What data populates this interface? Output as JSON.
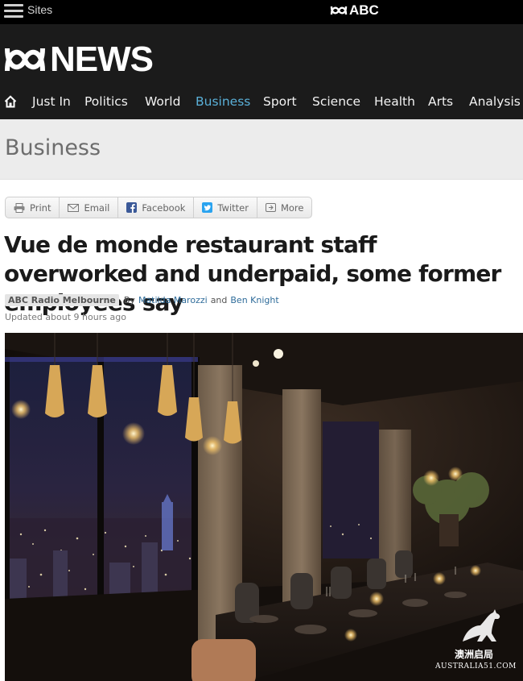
{
  "topbar": {
    "sites_label": "Sites",
    "abc_label": "ABC"
  },
  "brand": {
    "news_label": "NEWS"
  },
  "nav": {
    "items": [
      {
        "label": "Just In"
      },
      {
        "label": "Politics"
      },
      {
        "label": "World"
      },
      {
        "label": "Business"
      },
      {
        "label": "Sport"
      },
      {
        "label": "Science"
      },
      {
        "label": "Health"
      },
      {
        "label": "Arts"
      },
      {
        "label": "Analysis"
      }
    ],
    "active": "Business",
    "active_color": "#5ab0d8"
  },
  "section": {
    "title": "Business"
  },
  "share": {
    "buttons": [
      {
        "label": "Print",
        "icon": "printer-icon"
      },
      {
        "label": "Email",
        "icon": "envelope-icon"
      },
      {
        "label": "Facebook",
        "icon": "facebook-icon"
      },
      {
        "label": "Twitter",
        "icon": "twitter-icon"
      },
      {
        "label": "More",
        "icon": "more-icon"
      }
    ]
  },
  "article": {
    "headline": "Vue de monde restaurant staff overworked and underpaid, some former employees say",
    "program": "ABC Radio Melbourne",
    "by_label": "By",
    "author1": "Matilda Marozzi",
    "and_label": "and",
    "author2": "Ben Knight",
    "updated": "Updated about 9 hours ago"
  },
  "watermark": {
    "cn": "澳洲启局",
    "site": "AUSTRALIA51.COM"
  }
}
